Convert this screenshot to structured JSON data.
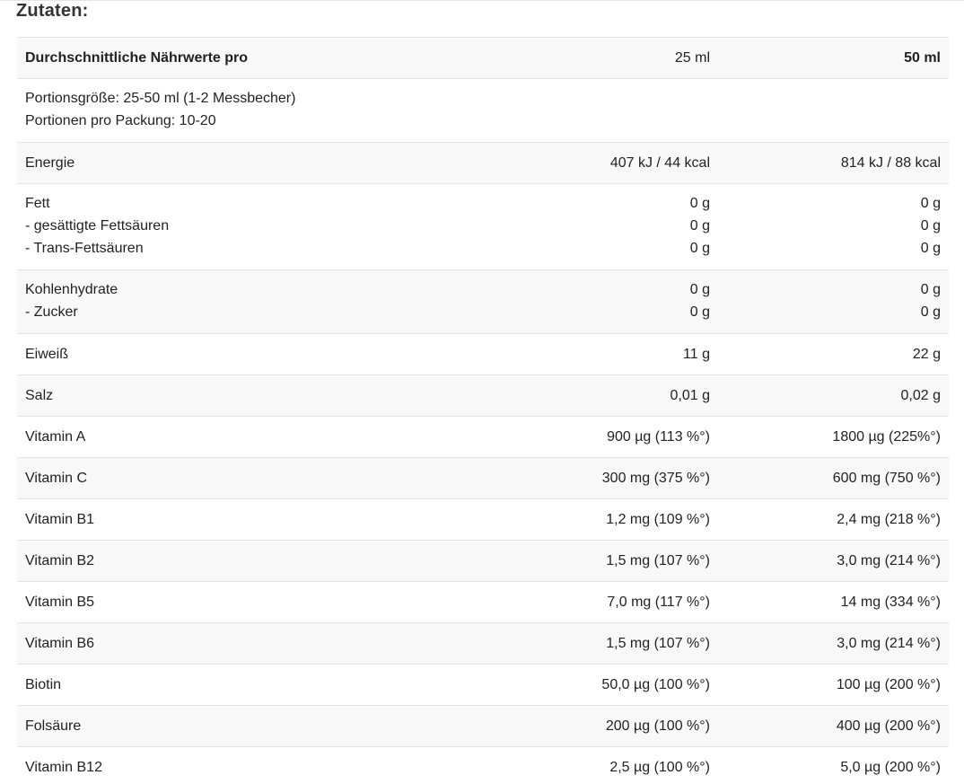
{
  "heading": "Zutaten:",
  "table": {
    "header": {
      "label": "Durchschnittliche Nährwerte pro",
      "col1": "25 ml",
      "col2": "50 ml"
    },
    "serving": {
      "line1": "Portionsgröße: 25-50 ml (1-2 Messbecher)",
      "line2": "Portionen pro Packung: 10-20"
    },
    "energy": {
      "name": "Energie",
      "v1": "407 kJ / 44 kcal",
      "v2": "814 kJ / 88 kcal"
    },
    "fat": {
      "names": [
        "Fett",
        "- gesättigte Fettsäuren",
        "- Trans-Fettsäuren"
      ],
      "v1": [
        "0 g",
        "0 g",
        "0 g"
      ],
      "v2": [
        "0 g",
        "0 g",
        "0 g"
      ]
    },
    "carbs": {
      "names": [
        "Kohlenhydrate",
        "- Zucker"
      ],
      "v1": [
        "0 g",
        "0 g"
      ],
      "v2": [
        "0 g",
        "0 g"
      ]
    },
    "rows": [
      {
        "name": "Eiweiß",
        "v1": "11 g",
        "v2": "22 g"
      },
      {
        "name": "Salz",
        "v1": "0,01 g",
        "v2": "0,02 g"
      },
      {
        "name": "Vitamin A",
        "v1": "900 µg (113 %°)",
        "v2": "1800 µg (225%°)"
      },
      {
        "name": "Vitamin C",
        "v1": "300 mg (375 %°)",
        "v2": "600 mg (750 %°)"
      },
      {
        "name": "Vitamin B1",
        "v1": "1,2 mg (109 %°)",
        "v2": "2,4 mg (218 %°)"
      },
      {
        "name": "Vitamin B2",
        "v1": "1,5 mg (107 %°)",
        "v2": "3,0 mg (214 %°)"
      },
      {
        "name": "Vitamin B5",
        "v1": "7,0 mg (117 %°)",
        "v2": "14 mg (334 %°)"
      },
      {
        "name": "Vitamin B6",
        "v1": "1,5 mg (107 %°)",
        "v2": "3,0 mg (214 %°)"
      },
      {
        "name": "Biotin",
        "v1": "50,0 µg (100 %°)",
        "v2": "100 µg (200 %°)"
      },
      {
        "name": "Folsäure",
        "v1": "200 µg (100 %°)",
        "v2": "400 µg (200 %°)"
      },
      {
        "name": "Vitamin B12",
        "v1": "2,5 µg (100 %°)",
        "v2": "5,0 µg (200 %°)"
      }
    ]
  }
}
